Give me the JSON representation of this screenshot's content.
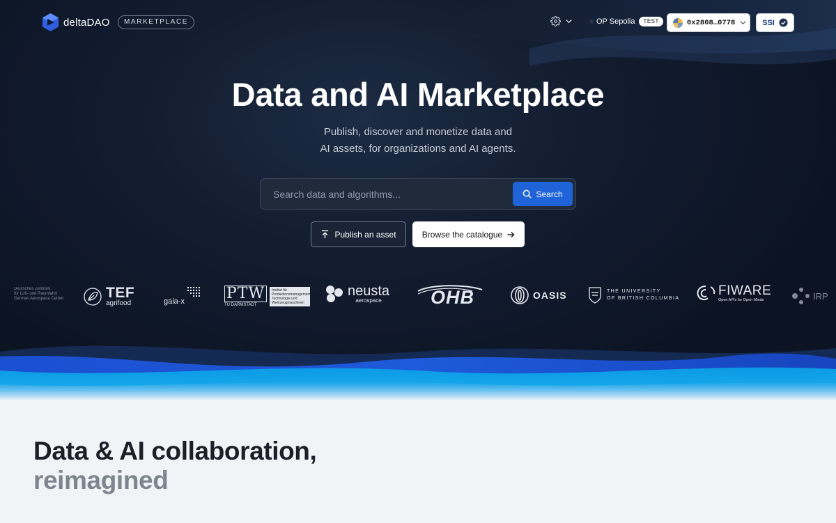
{
  "header": {
    "brand_name": "deltaDAO",
    "badge": "MARKETPLACE",
    "network_name": "OP Sepolia",
    "network_badge": "TEST",
    "wallet_address": "0x2808…0778",
    "ssi_label": "SSI"
  },
  "hero": {
    "title": "Data and AI Marketplace",
    "subtitle_line1": "Publish, discover and monetize data and",
    "subtitle_line2": "AI assets, for organizations and AI agents.",
    "search_placeholder": "Search data and algorithms...",
    "search_button": "Search",
    "publish_button": "Publish an asset",
    "browse_button": "Browse the catalogue"
  },
  "partners": {
    "dlr_line1": "Deutsches Zentrum",
    "dlr_line2": "für Luft- und Raumfahrt",
    "dlr_line3": "German Aerospace Center",
    "tef_name": "TEF",
    "tef_sub": "agrifood",
    "gaiax": "gaia-x",
    "ptw_name": "PTW",
    "ptw_sub": "TU DARMSTADT",
    "ptw_desc1": "Institut für",
    "ptw_desc2": "Produktionsmanagement,",
    "ptw_desc3": "Technologie und",
    "ptw_desc4": "Werkzeugmaschinen",
    "neusta_name": "neusta",
    "neusta_sub": "aerospace",
    "ohb": "OHB",
    "oasis": "OASIS",
    "ubc_line1": "THE UNIVERSITY",
    "ubc_line2": "OF BRITISH COLUMBIA",
    "fiware_name": "FIWARE",
    "fiware_sub": "Open APIs for Open Minds",
    "irp": "IRP"
  },
  "section": {
    "title_line1": "Data & AI collaboration,",
    "title_line2": "reimagined"
  },
  "colors": {
    "hero_bg": "#121b2d",
    "accent_blue": "#1f63d8",
    "wave_blue": "#1b56d6",
    "wave_cyan": "#0ea5e6",
    "page_bg": "#f1f4f6"
  },
  "icons": [
    "logo-mark",
    "gear-icon",
    "chevron-down-icon",
    "search-icon",
    "upload-icon",
    "arrow-right-icon",
    "check-circle-icon"
  ]
}
